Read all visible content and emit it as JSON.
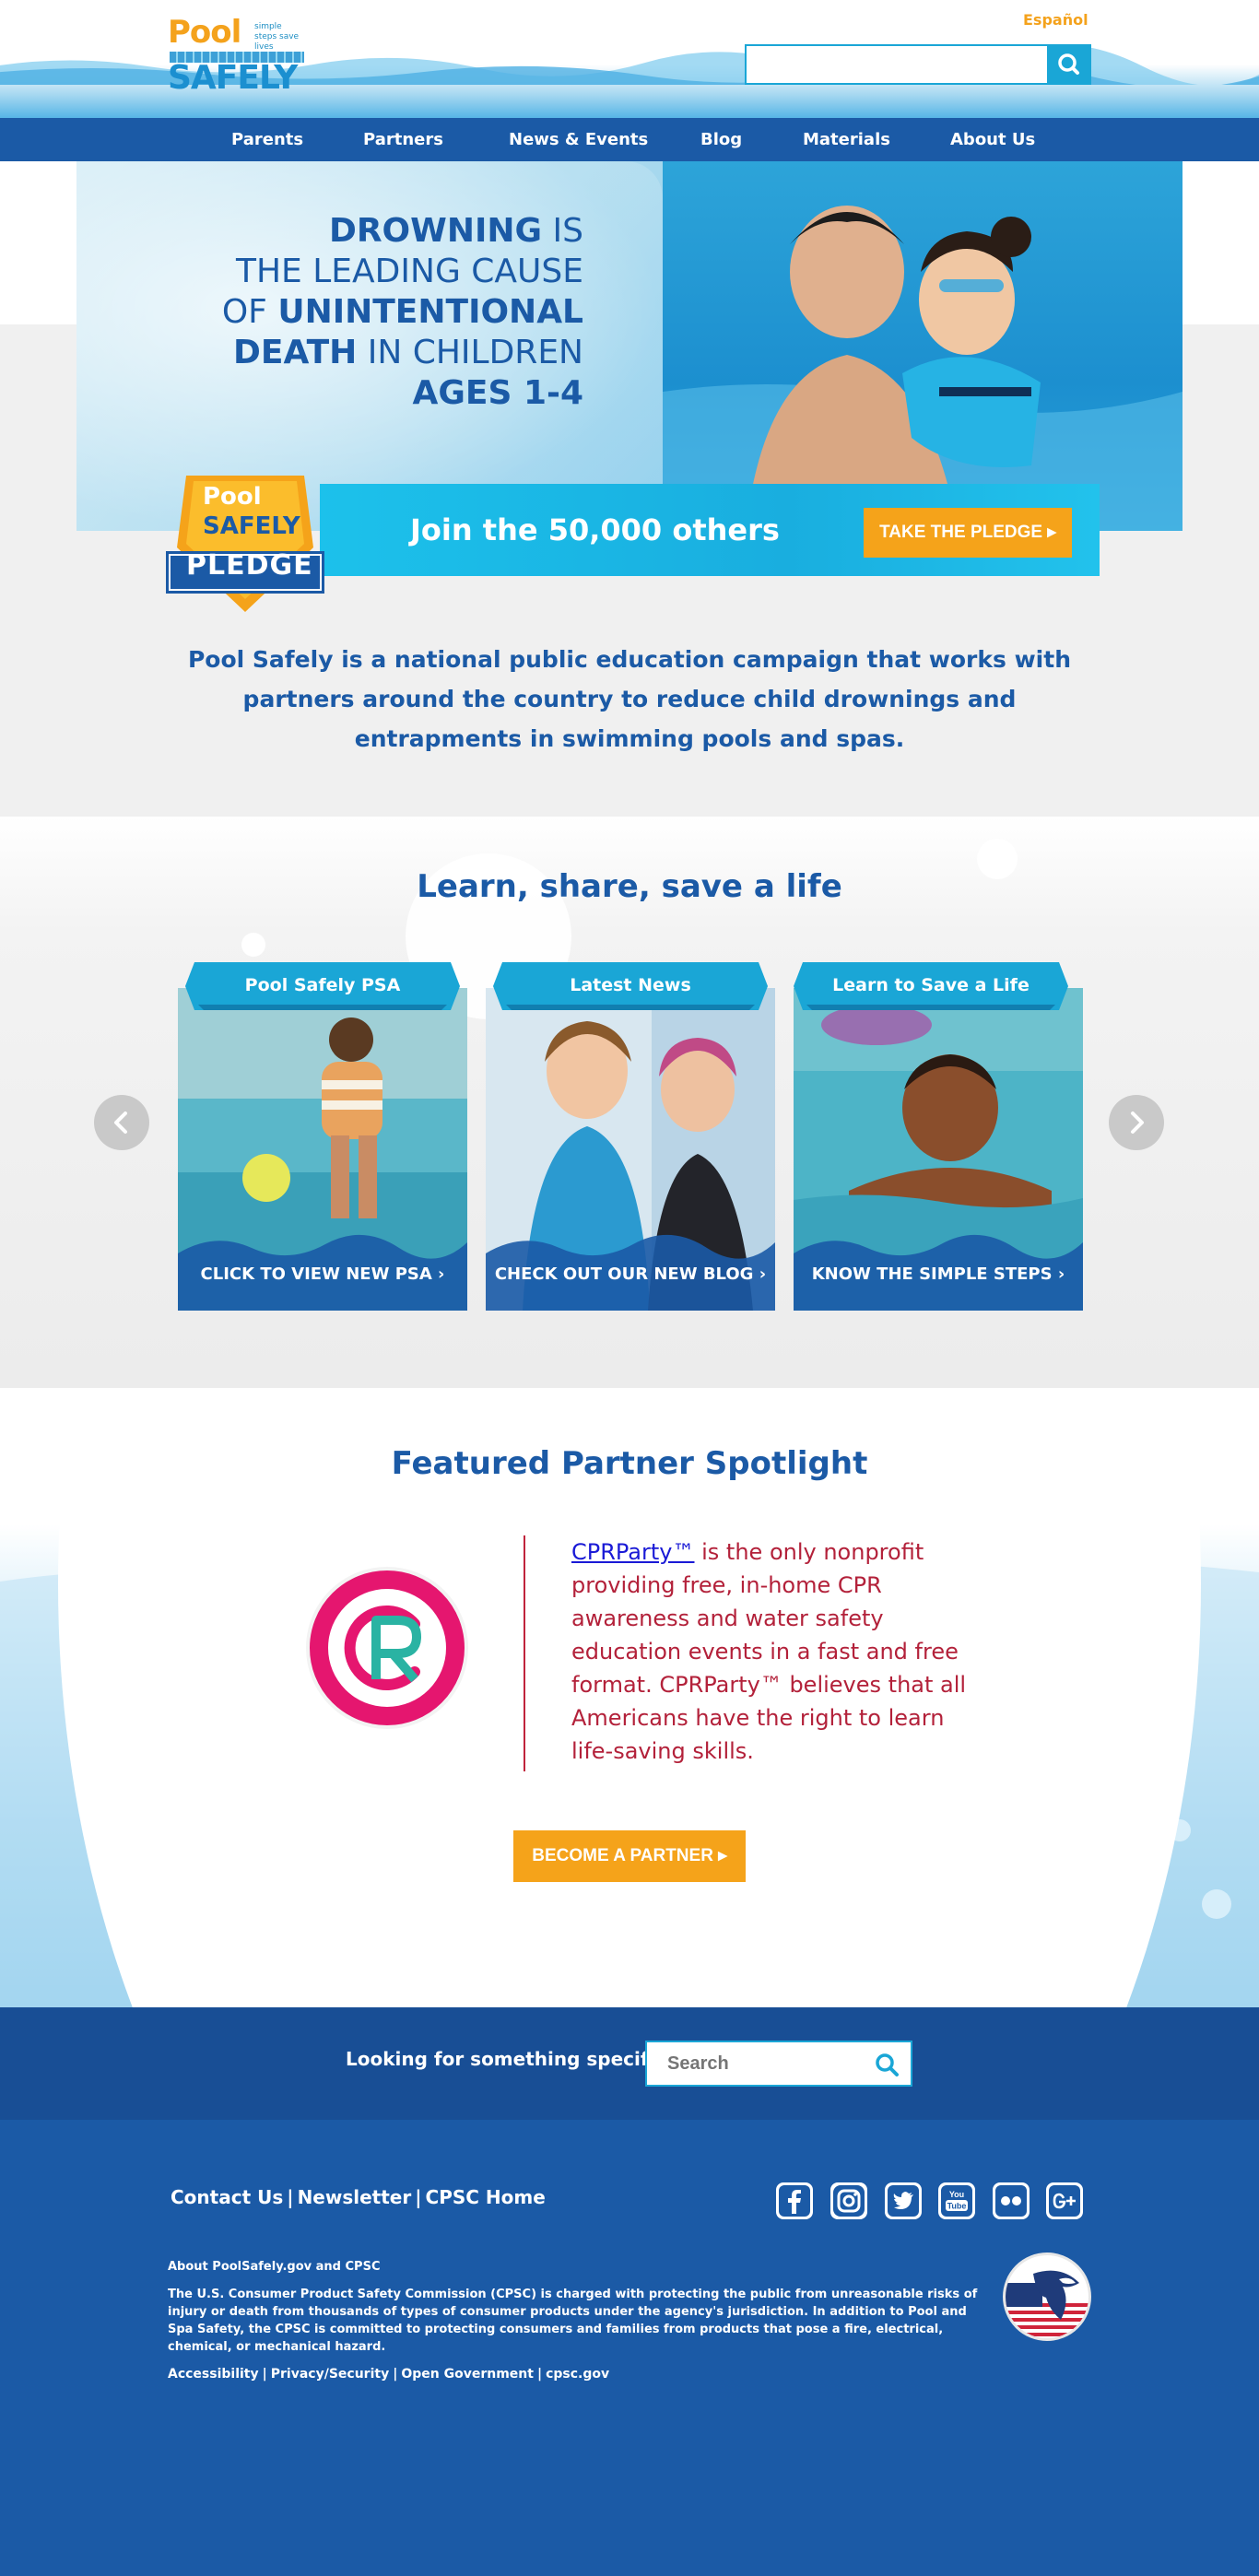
{
  "header": {
    "logo_pool": "Pool",
    "logo_tagline": "simple steps save lives",
    "logo_safely": "SAFELY",
    "language_link": "Español",
    "search_placeholder": ""
  },
  "nav": {
    "items": [
      {
        "label": "Parents"
      },
      {
        "label": "Partners"
      },
      {
        "label": "News & Events"
      },
      {
        "label": "Blog"
      },
      {
        "label": "Materials"
      },
      {
        "label": "About Us"
      }
    ]
  },
  "hero": {
    "line1_bold": "DROWNING",
    "line1_rest": " IS",
    "line2": "THE LEADING CAUSE",
    "line3_pre": "OF ",
    "line3_bold": "UNINTENTIONAL",
    "line4_bold": "DEATH",
    "line4_rest": " IN CHILDREN",
    "line5_bold": "AGES 1-4"
  },
  "pledge": {
    "badge_pool": "Pool",
    "badge_safely": "SAFELY",
    "badge_pledge": "PLEDGE",
    "join_text": "Join the 50,000 others",
    "button_label": "TAKE THE PLEDGE ▸"
  },
  "intro": {
    "text": "Pool Safely is a national public education campaign that works with partners around the country to reduce child drownings and entrapments in swimming pools and spas."
  },
  "learn": {
    "title": "Learn, share, save a life",
    "cards": [
      {
        "ribbon": "Pool Safely PSA",
        "cta": "CLICK TO VIEW NEW PSA ›"
      },
      {
        "ribbon": "Latest News",
        "cta": "CHECK OUT OUR NEW BLOG ›"
      },
      {
        "ribbon": "Learn to Save a Life",
        "cta": "KNOW THE SIMPLE STEPS ›"
      }
    ]
  },
  "partner": {
    "title": "Featured Partner Spotlight",
    "link_text": "CPRParty™",
    "description": " is the only nonprofit providing free, in-home CPR awareness and water safety education events in a fast and free format. CPRParty™ believes that all Americans have the right to learn life-saving skills.",
    "button_label": "BECOME A PARTNER ▸"
  },
  "search_strip": {
    "label": "Looking for something specific?",
    "placeholder": "Search"
  },
  "footer": {
    "links": [
      {
        "label": "Contact Us"
      },
      {
        "label": "Newsletter"
      },
      {
        "label": "CPSC Home"
      }
    ],
    "separator": "|",
    "social_icons": [
      "facebook-icon",
      "instagram-icon",
      "twitter-icon",
      "youtube-icon",
      "flickr-icon",
      "google-plus-icon"
    ],
    "about_heading": "About PoolSafely.gov and CPSC",
    "about_text": "The U.S. Consumer Product Safety Commission (CPSC) is charged with protecting the public from unreasonable risks of injury or death from thousands of types of consumer products under the agency's jurisdiction. In addition to Pool and Spa Safety, the CPSC is committed to protecting consumers and families from products that pose a fire, electrical, chemical, or mechanical hazard.",
    "bottom_links": [
      {
        "label": "Accessibility"
      },
      {
        "label": "Privacy/Security"
      },
      {
        "label": "Open Government"
      },
      {
        "label": "cpsc.gov"
      }
    ]
  },
  "colors": {
    "brand_blue": "#1b5aa6",
    "accent_cyan": "#1aa6d6",
    "accent_orange": "#f5a31a",
    "partner_red": "#b3213a",
    "cpr_pink": "#e5166f"
  }
}
